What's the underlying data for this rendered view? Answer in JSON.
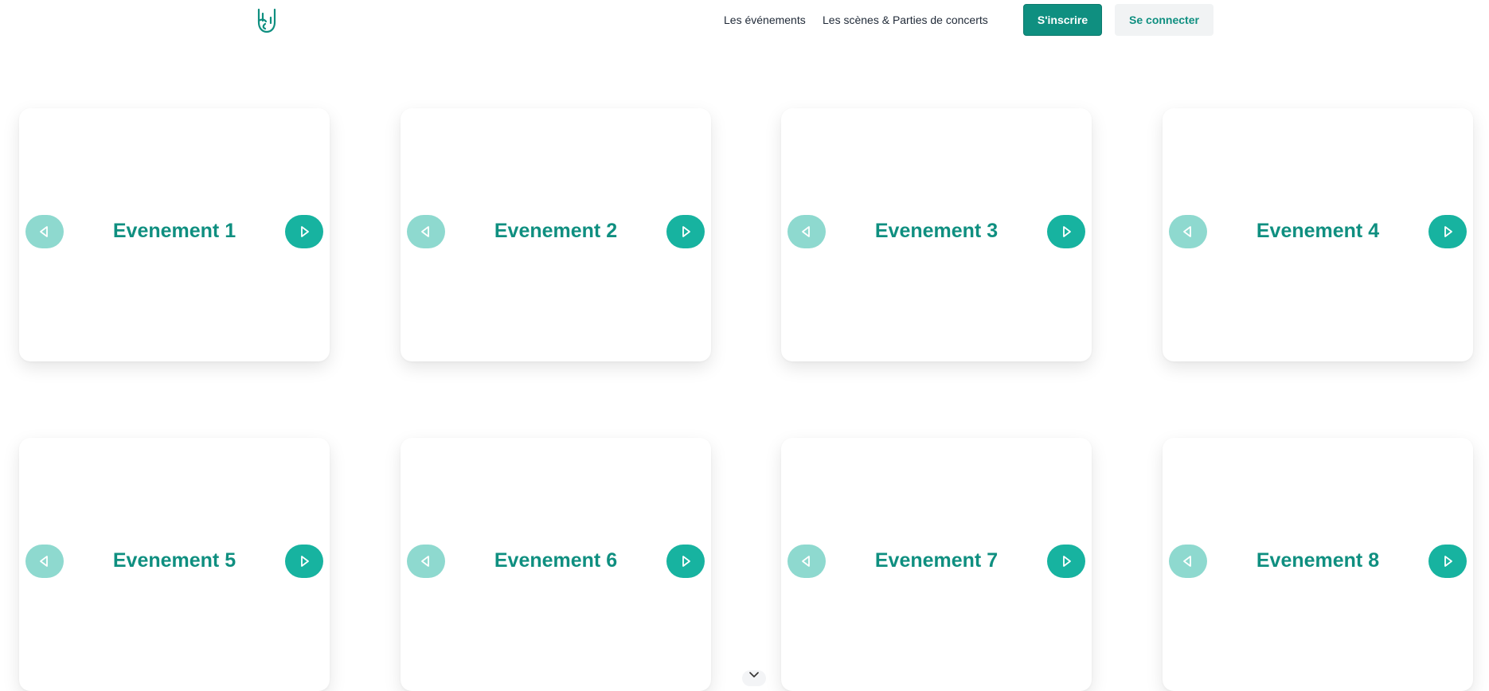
{
  "nav": {
    "logo_icon": "rock-hand-icon",
    "links": [
      "Les événements",
      "Les scènes & Parties de concerts"
    ],
    "signup_label": "S'inscrire",
    "login_label": "Se connecter"
  },
  "colors": {
    "brand": "#0f8f80",
    "arrow_prev_disabled": "#8ed9cf",
    "arrow_next": "#17b3a0"
  },
  "events": [
    {
      "title": "Evenement 1"
    },
    {
      "title": "Evenement 2"
    },
    {
      "title": "Evenement 3"
    },
    {
      "title": "Evenement 4"
    },
    {
      "title": "Evenement 5"
    },
    {
      "title": "Evenement 6"
    },
    {
      "title": "Evenement 7"
    },
    {
      "title": "Evenement 8"
    }
  ],
  "icons": {
    "prev": "triangle-left-icon",
    "next": "triangle-right-icon",
    "scroll": "chevron-down-icon"
  }
}
